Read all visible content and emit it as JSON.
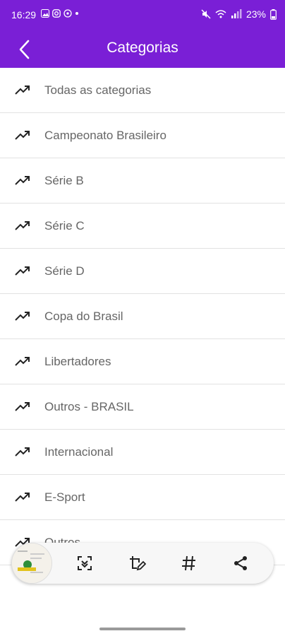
{
  "status_bar": {
    "time": "16:29",
    "battery": "23%",
    "left_icons": [
      "gallery-icon",
      "instagram-icon",
      "whatsapp-icon",
      "dot-icon"
    ],
    "right_icons": [
      "mute-icon",
      "wifi-icon",
      "signal-icon",
      "battery-icon"
    ]
  },
  "app_bar": {
    "title": "Categorias",
    "color": "#7a1fd6"
  },
  "categories": [
    {
      "label": "Todas as categorias"
    },
    {
      "label": "Campeonato Brasileiro"
    },
    {
      "label": "Série B"
    },
    {
      "label": "Série C"
    },
    {
      "label": "Série D"
    },
    {
      "label": "Copa do Brasil"
    },
    {
      "label": "Libertadores"
    },
    {
      "label": "Outros - BRASIL"
    },
    {
      "label": "Internacional"
    },
    {
      "label": "E-Sport"
    },
    {
      "label": "Outros"
    }
  ],
  "screenshot_toolbar": {
    "tools": [
      "scan-text-icon",
      "edit-crop-icon",
      "hashtag-icon",
      "share-icon"
    ]
  }
}
